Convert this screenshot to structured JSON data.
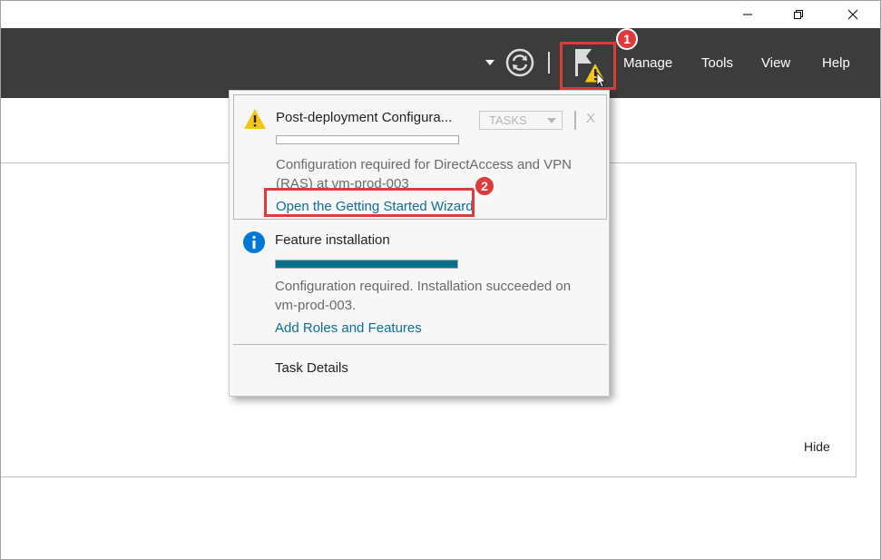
{
  "window": {
    "buttons": {
      "minimize_icon": "minimize-icon",
      "maximize_icon": "restore-icon",
      "close_icon": "close-icon"
    }
  },
  "header": {
    "menu": {
      "manage": "Manage",
      "tools": "Tools",
      "view": "View",
      "help": "Help"
    },
    "icons": {
      "dropdown": "caret-down-icon",
      "refresh": "refresh-icon",
      "notifications": "notification-flag-warning-icon"
    }
  },
  "annotations": {
    "badge_1": "1",
    "badge_2": "2"
  },
  "notifications": {
    "items": [
      {
        "icon": "warning-icon",
        "title": "Post-deployment Configura...",
        "tasks_label": "TASKS",
        "close_label": "X",
        "progress": 0,
        "description": "Configuration required for DirectAccess and VPN (RAS) at vm-prod-003",
        "link": "Open the Getting Started Wizard"
      },
      {
        "icon": "info-icon",
        "title": "Feature installation",
        "progress": 1.0,
        "description": "Configuration required. Installation succeeded on vm-prod-003.",
        "link": "Add Roles and Features"
      }
    ],
    "footer_label": "Task Details"
  },
  "content": {
    "hide_label": "Hide"
  },
  "colors": {
    "header_bg": "#3c3c3c",
    "accent_link": "#0e6e98",
    "progress_fill": "#006f8a",
    "annotation_red": "#e03b3b",
    "warning_yellow": "#f5c518",
    "info_blue": "#0078d7"
  }
}
